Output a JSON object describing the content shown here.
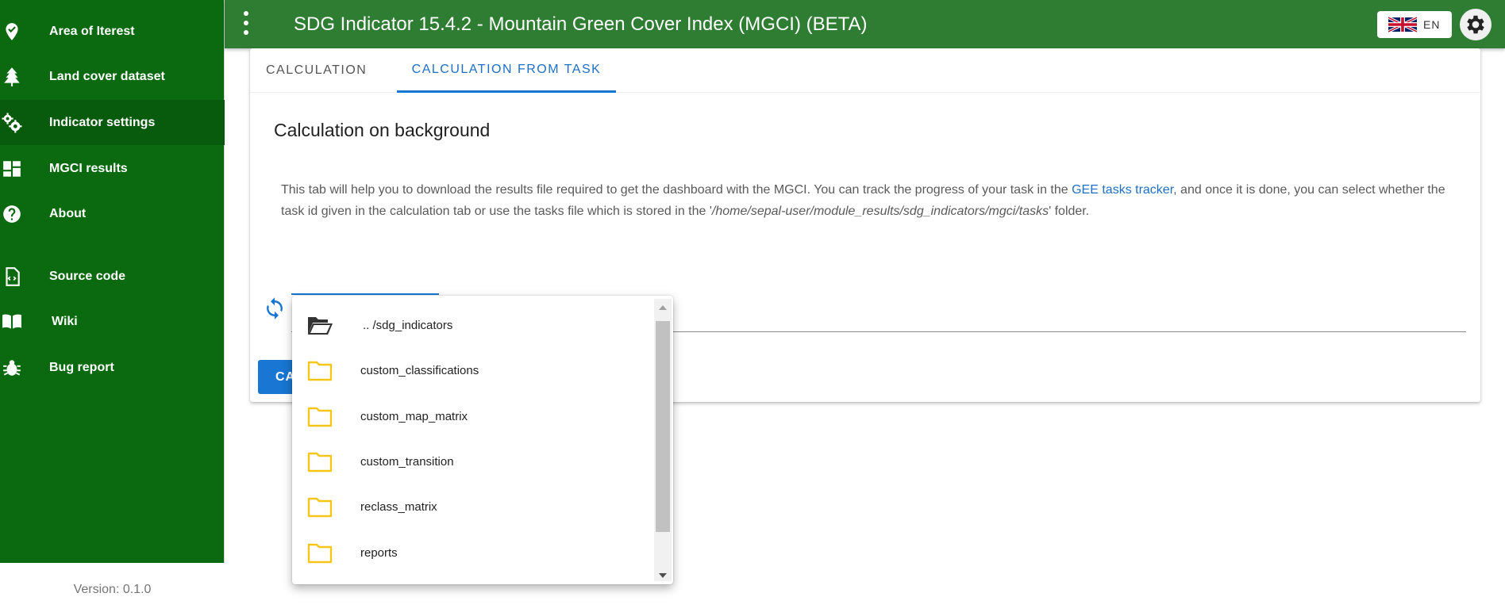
{
  "sidebar": {
    "items": [
      {
        "label": "Area of Iterest",
        "icon": "map-marker-check-icon"
      },
      {
        "label": "Land cover dataset",
        "icon": "pine-tree-icon"
      },
      {
        "label": "Indicator settings",
        "icon": "cogs-icon",
        "active": true
      },
      {
        "label": "MGCI results",
        "icon": "dashboard-icon"
      },
      {
        "label": "About",
        "icon": "question-circle-icon"
      },
      {
        "label": "Source code",
        "icon": "file-code-icon"
      },
      {
        "label": "Wiki",
        "icon": "book-open-icon"
      },
      {
        "label": "Bug report",
        "icon": "bug-icon"
      }
    ],
    "version": "Version: 0.1.0",
    "background_color": "#0b6a10"
  },
  "appbar": {
    "title": "SDG Indicator 15.4.2 - Mountain Green Cover Index (MGCI) (BETA)",
    "language": "EN",
    "color": "#2e7d32"
  },
  "tabs": [
    {
      "label": "CALCULATION"
    },
    {
      "label": "CALCULATION FROM TASK",
      "active": true
    }
  ],
  "panel": {
    "title": "Calculation on background",
    "desc_part1": "This tab will help you to download the results file required to get the dashboard with the MGCI. You can track the progress of your task in the ",
    "desc_link": "GEE tasks tracker",
    "desc_part2": ", and once it is done, you can select whether the task id given in the calculation tab or use the tasks file which is stored in the '",
    "desc_path": "/home/sepal-user/module_results/sdg_indicators/mgci/tasks",
    "desc_part3": "' folder.",
    "button_label": "CALCULATE"
  },
  "file_menu": {
    "items": [
      {
        "label": ".. /sdg_indicators",
        "icon": "folder-open-icon"
      },
      {
        "label": "custom_classifications",
        "icon": "folder-icon"
      },
      {
        "label": "custom_map_matrix",
        "icon": "folder-icon"
      },
      {
        "label": "custom_transition",
        "icon": "folder-icon"
      },
      {
        "label": "reclass_matrix",
        "icon": "folder-icon"
      },
      {
        "label": "reports",
        "icon": "folder-icon"
      }
    ]
  },
  "colors": {
    "accent": "#1976d2",
    "folder": "#f5c518"
  }
}
